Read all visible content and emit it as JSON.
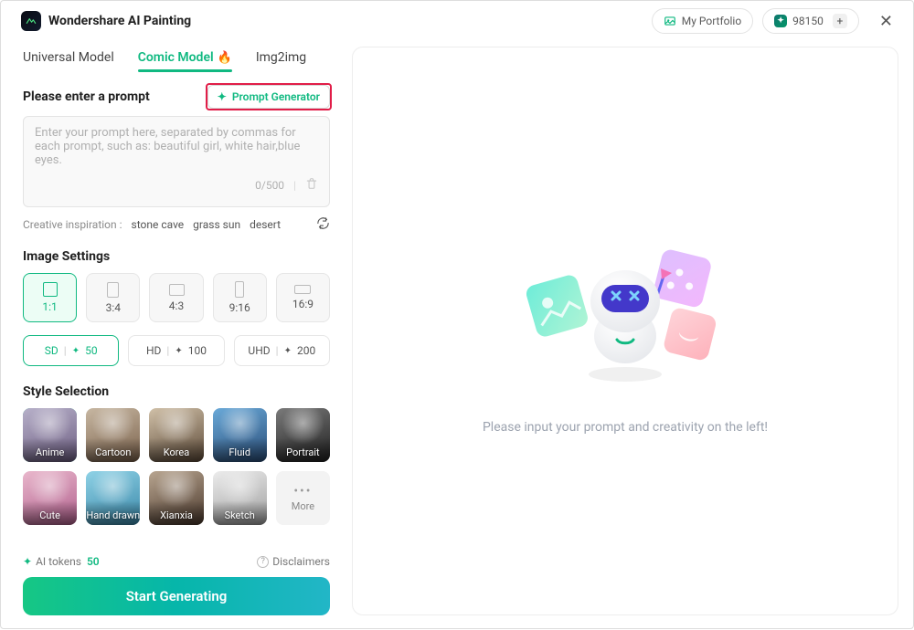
{
  "header": {
    "app_title": "Wondershare AI Painting",
    "my_portfolio": "My Portfolio",
    "points": "98150",
    "close_glyph": "✕"
  },
  "tabs": [
    {
      "label": "Universal Model",
      "active": false
    },
    {
      "label": "Comic Model",
      "active": true,
      "hot": true
    },
    {
      "label": "Img2img",
      "active": false
    }
  ],
  "prompt": {
    "section_label": "Please enter a prompt",
    "generator_label": "Prompt Generator",
    "placeholder": "Enter your prompt here, separated by commas for each prompt, such as: beautiful girl, white hair,blue eyes.",
    "counter": "0/500"
  },
  "inspiration": {
    "label": "Creative inspiration :",
    "items": [
      "stone cave",
      "grass sun",
      "desert"
    ]
  },
  "image_settings": {
    "section_label": "Image Settings",
    "ratios": [
      {
        "label": "1:1",
        "w": 16,
        "h": 16,
        "active": true
      },
      {
        "label": "3:4",
        "w": 13,
        "h": 17,
        "active": false
      },
      {
        "label": "4:3",
        "w": 17,
        "h": 13,
        "active": false
      },
      {
        "label": "9:16",
        "w": 10,
        "h": 18,
        "active": false
      },
      {
        "label": "16:9",
        "w": 18,
        "h": 10,
        "active": false
      }
    ],
    "qualities": [
      {
        "label": "SD",
        "cost": "50",
        "active": true
      },
      {
        "label": "HD",
        "cost": "100",
        "active": false
      },
      {
        "label": "UHD",
        "cost": "200",
        "active": false
      }
    ]
  },
  "style_selection": {
    "section_label": "Style Selection",
    "styles": [
      {
        "label": "Anime",
        "bg": "linear-gradient(160deg,#b7b0c9,#6d5e82)",
        "active": true
      },
      {
        "label": "Cartoon",
        "bg": "linear-gradient(160deg,#c7b7a2,#7a614b)"
      },
      {
        "label": "Korea",
        "bg": "linear-gradient(160deg,#d0c0a8,#5d4a38)"
      },
      {
        "label": "Fluid",
        "bg": "linear-gradient(160deg,#6aa9d8,#2a4d78)"
      },
      {
        "label": "Portrait",
        "bg": "linear-gradient(160deg,#7a7a7a,#1f1f1f)"
      },
      {
        "label": "Cute",
        "bg": "linear-gradient(160deg,#e9b7cc,#b05f8c)"
      },
      {
        "label": "Hand drawn",
        "bg": "linear-gradient(160deg,#8fd2e6,#3a87a8)"
      },
      {
        "label": "Xianxia",
        "bg": "linear-gradient(160deg,#b8a590,#4a382c)"
      },
      {
        "label": "Sketch",
        "bg": "linear-gradient(160deg,#ececec,#9e9e9e)"
      }
    ],
    "more_label": "More"
  },
  "footer": {
    "tokens_label": "AI tokens",
    "tokens_value": "50",
    "disclaimers": "Disclaimers",
    "primary_cta": "Start Generating"
  },
  "preview": {
    "hint": "Please input your prompt and creativity on the left!"
  }
}
